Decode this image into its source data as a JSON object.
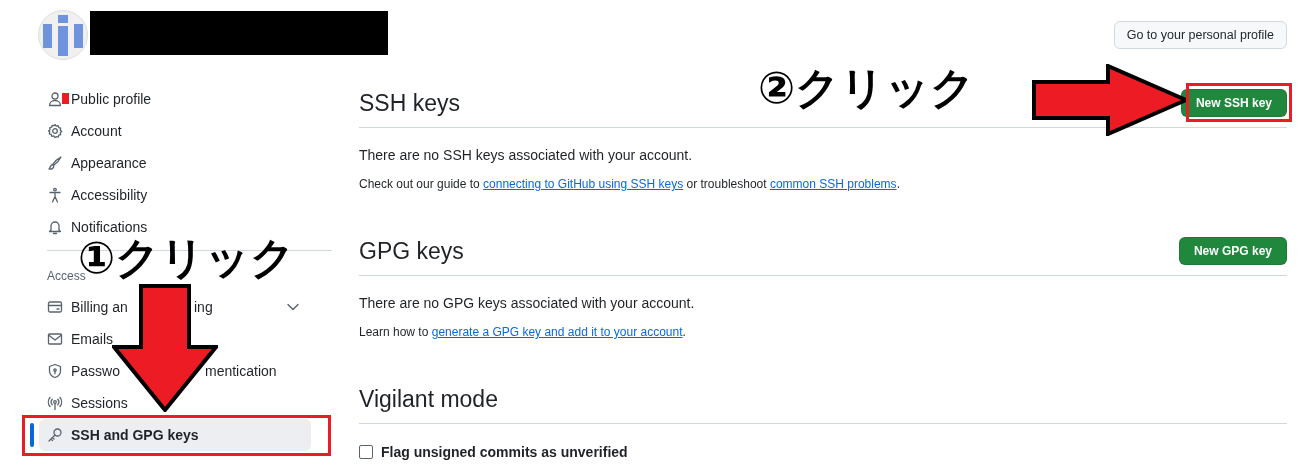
{
  "header": {
    "profile_button": "Go to your personal profile"
  },
  "sidebar": {
    "sections": [
      {
        "items": [
          {
            "label": "Public profile",
            "selected": false,
            "has_submenu": false
          },
          {
            "label": "Account",
            "selected": false,
            "has_submenu": false
          },
          {
            "label": "Appearance",
            "selected": false,
            "has_submenu": false
          },
          {
            "label": "Accessibility",
            "selected": false,
            "has_submenu": false
          },
          {
            "label": "Notifications",
            "selected": false,
            "has_submenu": false
          }
        ]
      },
      {
        "heading": "Access",
        "items": [
          {
            "label": "Billing an",
            "label_end": "ing",
            "selected": false,
            "has_submenu": true
          },
          {
            "label": "Emails",
            "selected": false,
            "has_submenu": false
          },
          {
            "label": "Passwo",
            "label_end": "mentication",
            "selected": false,
            "has_submenu": false
          },
          {
            "label": "Sessions",
            "selected": false,
            "has_submenu": false
          },
          {
            "label": "SSH and GPG keys",
            "selected": true,
            "has_submenu": false
          }
        ]
      }
    ]
  },
  "sections": [
    {
      "title": "SSH keys",
      "button": "New SSH key",
      "paragraphs": [
        {
          "kind": "description",
          "segments": [
            {
              "text": "There are no SSH keys associated with your account."
            }
          ]
        },
        {
          "kind": "help",
          "segments": [
            {
              "text": "Check out our guide to "
            },
            {
              "link": "connecting to GitHub using SSH keys"
            },
            {
              "text": " or troubleshoot "
            },
            {
              "link": "common SSH problems"
            },
            {
              "text": "."
            }
          ]
        }
      ]
    },
    {
      "title": "GPG keys",
      "button": "New GPG key",
      "paragraphs": [
        {
          "kind": "description",
          "segments": [
            {
              "text": "There are no GPG keys associated with your account."
            }
          ]
        },
        {
          "kind": "help",
          "segments": [
            {
              "text": "Learn how to "
            },
            {
              "link": "generate a GPG key and add it to your account"
            },
            {
              "text": "."
            }
          ]
        }
      ]
    },
    {
      "title": "Vigilant mode",
      "checkbox": {
        "label": "Flag unsigned commits as unverified",
        "checked": false
      }
    }
  ],
  "annotations": [
    {
      "kind": "mark"
    },
    {
      "kind": "label",
      "text": "②クリック"
    },
    {
      "kind": "right-arrow"
    },
    {
      "kind": "highlight"
    },
    {
      "kind": "label",
      "text": "①クリック"
    },
    {
      "kind": "down-arrow"
    },
    {
      "kind": "highlight"
    }
  ]
}
